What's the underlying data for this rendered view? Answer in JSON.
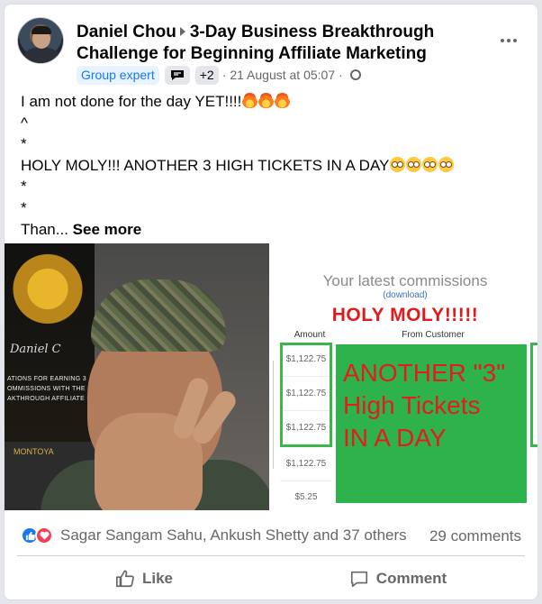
{
  "post": {
    "author": "Daniel Chou",
    "group": "3-Day Business Breakthrough Challenge for Beginning Affiliate Marketing",
    "badge": "Group expert",
    "badge_more": "+2",
    "separator": "·",
    "timestamp": "21 August at 05:07",
    "more_icon": "more-horizontal-icon",
    "privacy_icon": "globe-icon"
  },
  "body": {
    "line1": "I am not done for the day YET!!!!",
    "line2": "^",
    "line3": "*",
    "line4": "HOLY MOLY!!! ANOTHER 3 HIGH TICKETS IN A DAY",
    "line5": "*",
    "line6": "*",
    "truncated": "Than...",
    "see_more": "See more"
  },
  "image": {
    "poster_text": "ATIONS FOR EARNING 3 OMMISSIONS WITH THE AKTHROUGH AFFILIATE P",
    "poster_sign": "Daniel C",
    "poster_brand": "MONTOYA",
    "shot_title": "Your latest commissions",
    "shot_download": "(download)",
    "shot_holy": "HOLY MOLY!!!!!",
    "col_amount": "Amount",
    "col_customer": "From Customer",
    "amounts": [
      "$1,122.75",
      "$1,122.75",
      "$1,122.75",
      "$1,122.75",
      "$5.25"
    ],
    "overlay_line1": "ANOTHER \"3\"",
    "overlay_line2": "High Tickets",
    "overlay_line3": "IN A DAY"
  },
  "footer": {
    "reaction_names": "Sagar Sangam Sahu, Ankush Shetty and 37 others",
    "comments": "29 comments",
    "like_label": "Like",
    "comment_label": "Comment"
  },
  "colors": {
    "accent": "#1877f2",
    "love": "#f33e58",
    "overlay_green": "#2eb24c",
    "overlay_red": "#e51c1c"
  }
}
